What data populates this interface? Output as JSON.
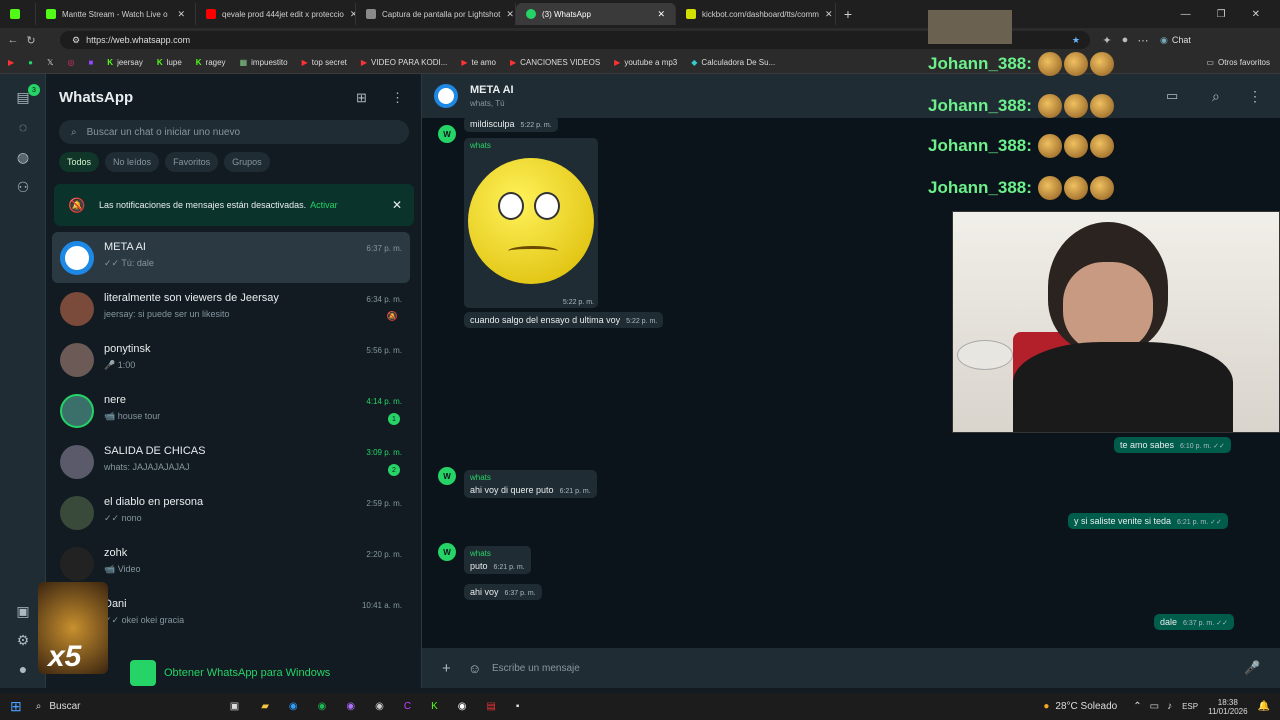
{
  "browser": {
    "tabs": [
      {
        "label": "Mantte Stream - Watch Live o",
        "color": "#53fc18"
      },
      {
        "label": "qevale prod 444jet edit x proteccio",
        "color": "#ff0000"
      },
      {
        "label": "Captura de pantalla por Lightshot",
        "color": "#8a8a8a"
      },
      {
        "label": "(3) WhatsApp",
        "color": "#25d366",
        "active": true
      },
      {
        "label": "kickbot.com/dashboard/tts/comm",
        "color": "#d4e000"
      }
    ],
    "url": "https://web.whatsapp.com",
    "chat_label": "Chat",
    "bookmarks": [
      {
        "label": "jeersay"
      },
      {
        "label": "lupe"
      },
      {
        "label": "ragey"
      },
      {
        "label": "impuestito"
      },
      {
        "label": "top secret"
      },
      {
        "label": "VIDEO PARA KODI..."
      },
      {
        "label": "te amo"
      },
      {
        "label": "CANCIONES VIDEOS"
      },
      {
        "label": "youtube a mp3"
      },
      {
        "label": "Calculadora De Su..."
      }
    ],
    "other_bookmarks": "Otros favoritos"
  },
  "rail": {
    "badge": "3"
  },
  "sidebar": {
    "title": "WhatsApp",
    "search_placeholder": "Buscar un chat o iniciar uno nuevo",
    "filters": [
      "Todos",
      "No leídos",
      "Favoritos",
      "Grupos"
    ],
    "notification": {
      "text": "Las notificaciones de mensajes están desactivadas.",
      "action": "Activar"
    },
    "chats": [
      {
        "name": "META AI",
        "preview": "✓✓ Tú: dale",
        "time": "6:37 p. m.",
        "color": "#1e88e5"
      },
      {
        "name": "literalmente son viewers de Jeersay",
        "preview": "jeersay: si puede ser un likesito",
        "time": "6:34 p. m.",
        "color": "#7a4a3a"
      },
      {
        "name": "ponytinsk",
        "preview": "🎤 1:00",
        "time": "5:56 p. m.",
        "color": "#6b5a55"
      },
      {
        "name": "nere",
        "preview": "📹 house tour",
        "time": "4:14 p. m.",
        "badge": "1",
        "color": "#3a6f6a",
        "green": true
      },
      {
        "name": "SALIDA DE CHICAS",
        "preview": "whats: JAJAJAJAJAJ",
        "time": "3:09 p. m.",
        "badge": "2",
        "color": "#5a5a6a",
        "green": true
      },
      {
        "name": "el diablo en persona",
        "preview": "✓✓ nono",
        "time": "2:59 p. m.",
        "color": "#3a4a3a"
      },
      {
        "name": "zohk",
        "preview": "📹 Video",
        "time": "2:20 p. m.",
        "color": "#222222"
      },
      {
        "name": "Dani",
        "preview": "✓✓ okei okei gracia",
        "time": "10:41 a. m.",
        "color": "#6a5040"
      }
    ],
    "get_app": "Obtener WhatsApp para Windows"
  },
  "conversation": {
    "name": "META AI",
    "subtitle": "whats, Tú",
    "messages": [
      {
        "text": "mildisculpa",
        "time": "5:22 p. m."
      },
      {
        "sender": "whats",
        "time": "5:22 p. m."
      },
      {
        "text": "cuando salgo del ensayo d ultima voy",
        "time": "5:22 p. m."
      },
      {
        "text": "te amo sabes",
        "time": "6:10 p. m. ✓✓"
      },
      {
        "sender": "whats",
        "text": "ahi voy di quere puto",
        "time": "6:21 p. m."
      },
      {
        "text": "y si saliste venite si teda",
        "time": "6:21 p. m. ✓✓"
      },
      {
        "sender": "whats",
        "text": "puto",
        "time": "6:21 p. m."
      },
      {
        "text": "ahi voy",
        "time": "6:37 p. m."
      },
      {
        "text": "dale",
        "time": "6:37 p. m. ✓✓"
      }
    ],
    "composer_placeholder": "Escribe un mensaje"
  },
  "overlay": {
    "chat_lines": [
      "Johann_388:",
      "Johann_388:",
      "Johann_388:",
      "Johann_388:"
    ],
    "x5": "x5"
  },
  "taskbar": {
    "search": "Buscar",
    "weather": "28°C Soleado",
    "lang": "ESP",
    "time": "18:38",
    "date": "11/01/2026"
  }
}
